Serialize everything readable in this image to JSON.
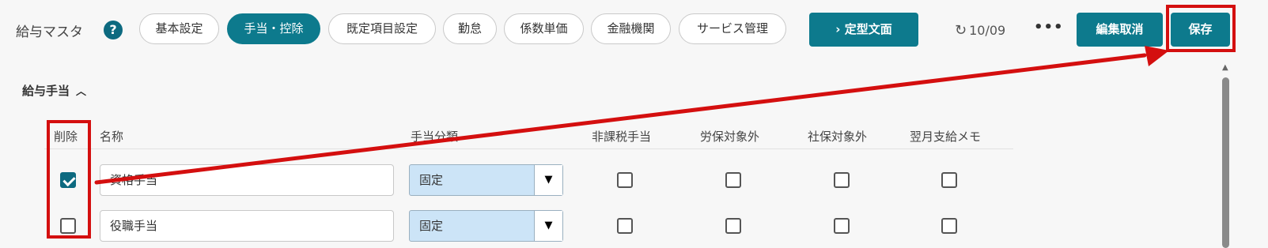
{
  "header": {
    "title": "給与マスタ",
    "help_icon": "?",
    "tabs": [
      {
        "label": "基本設定"
      },
      {
        "label": "手当・控除",
        "active": true
      },
      {
        "label": "既定項目設定"
      },
      {
        "label": "勤怠"
      },
      {
        "label": "係数単価"
      },
      {
        "label": "金融機関"
      },
      {
        "label": "サービス管理"
      }
    ],
    "template_button": "›  定型文面",
    "history_date": "10/09",
    "more": "•••",
    "cancel_button": "編集取消",
    "save_button": "保存"
  },
  "section": {
    "title": "給与手当",
    "collapse_icon": "chevron-up-icon"
  },
  "table": {
    "columns": [
      "削除",
      "名称",
      "手当分類",
      "非課税手当",
      "労保対象外",
      "社保対象外",
      "翌月支給メモ"
    ],
    "rows": [
      {
        "delete": true,
        "name": "資格手当",
        "category": "固定",
        "non_taxable": false,
        "labor_insurance_excluded": false,
        "social_insurance_excluded": false,
        "next_month_memo": false
      },
      {
        "delete": false,
        "name": "役職手当",
        "category": "固定",
        "non_taxable": false,
        "labor_insurance_excluded": false,
        "social_insurance_excluded": false,
        "next_month_memo": false
      }
    ]
  },
  "colors": {
    "accent": "#0d7a8d",
    "annotation": "#d40f0f",
    "select_bg": "#cce4f7"
  }
}
